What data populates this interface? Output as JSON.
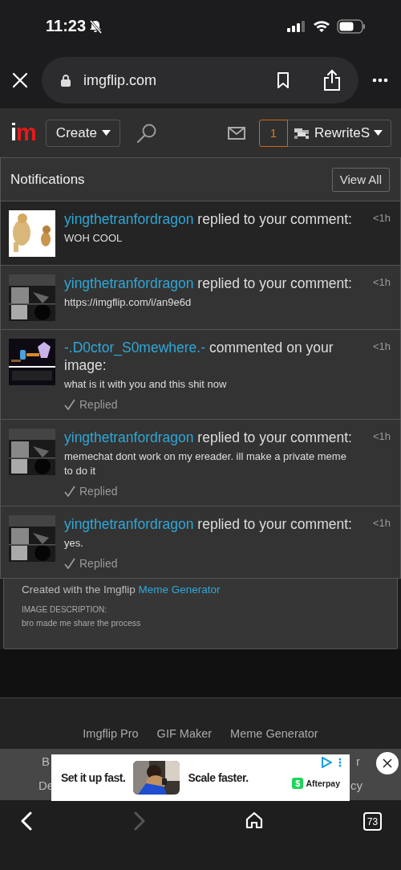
{
  "status_bar": {
    "time": "11:23",
    "silent": true
  },
  "browser": {
    "url": "imgflip.com"
  },
  "site_header": {
    "logo": "im",
    "create_label": "Create",
    "notification_count": "1",
    "username": "RewriteS"
  },
  "notifications": {
    "title": "Notifications",
    "view_all": "View All",
    "items": [
      {
        "user": "yingthetranfordragon",
        "action": "replied to your comment:",
        "time": "<1h",
        "message": "WOH COOL",
        "unread": true,
        "replied": false
      },
      {
        "user": "yingthetranfordragon",
        "action": "replied to your comment:",
        "time": "<1h",
        "message": "https://imgflip.com/i/an9e6d",
        "unread": false,
        "replied": false
      },
      {
        "user": "-.D0ctor_S0mewhere.-",
        "action": "commented on your image:",
        "time": "<1h",
        "message": "what is it with you and this shit now",
        "unread": false,
        "replied": true,
        "replied_label": "Replied"
      },
      {
        "user": "yingthetranfordragon",
        "action": "replied to your comment:",
        "time": "<1h",
        "message": "memechat dont work on my ereader. ill make a private meme to do it",
        "unread": false,
        "replied": true,
        "replied_label": "Replied"
      },
      {
        "user": "yingthetranfordragon",
        "action": "replied to your comment:",
        "time": "<1h",
        "message": "yes.",
        "unread": false,
        "replied": true,
        "replied_label": "Replied"
      }
    ]
  },
  "image_info": {
    "caption_prefix": "Created with the Imgflip",
    "caption_link": "Meme Generator",
    "description_label": "IMAGE DESCRIPTION:",
    "description": "bro made me share the process"
  },
  "footer": {
    "links": [
      "Imgflip Pro",
      "GIF Maker",
      "Meme Generator"
    ],
    "partial_row_1": [
      "B",
      "r"
    ],
    "partial_row_2": [
      "De",
      "cy"
    ]
  },
  "ad": {
    "headline": "Set it up fast.",
    "tagline": "Scale faster.",
    "brand": "Afterpay",
    "brand_mark": "$"
  },
  "toolbar": {
    "tab_count": "73",
    "back_disabled": false,
    "forward_disabled": true
  }
}
